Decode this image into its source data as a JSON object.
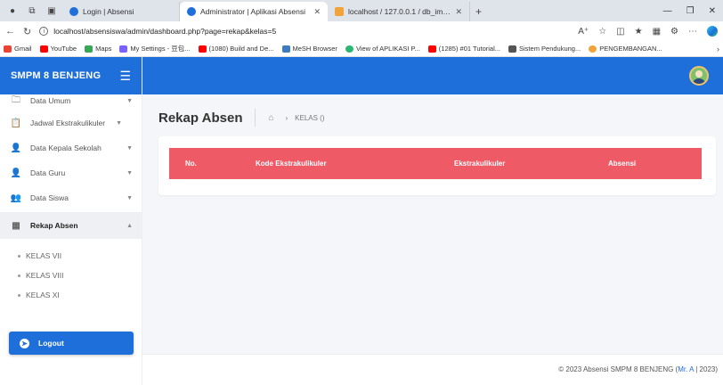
{
  "browser": {
    "tabs": [
      {
        "title": "Login | Absensi",
        "active": false
      },
      {
        "title": "Administrator | Aplikasi Absensi",
        "active": true
      },
      {
        "title": "localhost / 127.0.0.1 / db_imas /",
        "active": false
      }
    ],
    "url": "localhost/absensiswa/admin/dashboard.php?page=rekap&kelas=5",
    "bookmarks": [
      "Gmail",
      "YouTube",
      "Maps",
      "My Settings - 豆包...",
      "(1080) Build and De...",
      "MeSH Browser",
      "View of APLIKASI P...",
      "(1285) #01 Tutorial...",
      "Sistem Pendukung...",
      "PENGEMBANGAN..."
    ]
  },
  "sidebar": {
    "brand": "SMPM 8 BENJENG",
    "items": [
      {
        "label": "Data Umum",
        "icon": "folder-icon"
      },
      {
        "label": "Jadwal Ekstrakulikuler",
        "icon": "clipboard-icon"
      },
      {
        "label": "Data Kepala Sekolah",
        "icon": "user-icon"
      },
      {
        "label": "Data Guru",
        "icon": "user-icon"
      },
      {
        "label": "Data Siswa",
        "icon": "users-icon"
      },
      {
        "label": "Rekap Absen",
        "icon": "table-icon"
      }
    ],
    "subitems": [
      "KELAS VII",
      "KELAS VIII",
      "KELAS XI"
    ],
    "logout_label": "Logout"
  },
  "main": {
    "page_title": "Rekap Absen",
    "breadcrumb": "KELAS ()",
    "table_headers": [
      "No.",
      "Kode Ekstrakulikuler",
      "Ekstrakulikuler",
      "Absensi"
    ]
  },
  "footer": {
    "text": "© 2023 Absensi SMPM 8 BENJENG (",
    "link": "Mr. A",
    "suffix": " | 2023)"
  },
  "colors": {
    "primary": "#1e6fd9",
    "table_header": "#ef5a67"
  }
}
